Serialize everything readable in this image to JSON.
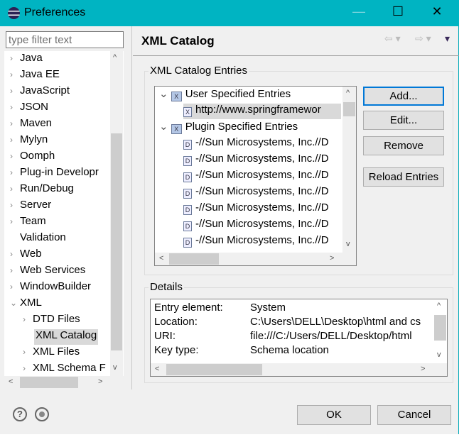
{
  "window": {
    "title": "Preferences",
    "minimize": "—",
    "maximize": "☐",
    "close": "✕"
  },
  "sidebar": {
    "filter_placeholder": "type filter text",
    "items": [
      {
        "label": "Java",
        "expanded": false,
        "level": 0
      },
      {
        "label": "Java EE",
        "expanded": false,
        "level": 0
      },
      {
        "label": "JavaScript",
        "expanded": false,
        "level": 0
      },
      {
        "label": "JSON",
        "expanded": false,
        "level": 0
      },
      {
        "label": "Maven",
        "expanded": false,
        "level": 0
      },
      {
        "label": "Mylyn",
        "expanded": false,
        "level": 0
      },
      {
        "label": "Oomph",
        "expanded": false,
        "level": 0
      },
      {
        "label": "Plug-in Developr",
        "expanded": false,
        "level": 0
      },
      {
        "label": "Run/Debug",
        "expanded": false,
        "level": 0
      },
      {
        "label": "Server",
        "expanded": false,
        "level": 0
      },
      {
        "label": "Team",
        "expanded": false,
        "level": 0
      },
      {
        "label": "Validation",
        "expanded": null,
        "level": 0
      },
      {
        "label": "Web",
        "expanded": false,
        "level": 0
      },
      {
        "label": "Web Services",
        "expanded": false,
        "level": 0
      },
      {
        "label": "WindowBuilder",
        "expanded": false,
        "level": 0
      },
      {
        "label": "XML",
        "expanded": true,
        "level": 0
      },
      {
        "label": "DTD Files",
        "expanded": false,
        "level": 1
      },
      {
        "label": "XML Catalog",
        "expanded": null,
        "level": 1,
        "selected": true
      },
      {
        "label": "XML Files",
        "expanded": false,
        "level": 1
      },
      {
        "label": "XML Schema F",
        "expanded": false,
        "level": 1
      }
    ]
  },
  "page": {
    "title": "XML Catalog",
    "entries_group": "XML Catalog Entries",
    "tree": [
      {
        "label": "User Specified Entries",
        "type": "category"
      },
      {
        "label": "http://www.springframewor",
        "type": "entry",
        "selected": true
      },
      {
        "label": "Plugin Specified Entries",
        "type": "category"
      },
      {
        "label": "-//Sun Microsystems, Inc.//D",
        "type": "dtd"
      },
      {
        "label": "-//Sun Microsystems, Inc.//D",
        "type": "dtd"
      },
      {
        "label": "-//Sun Microsystems, Inc.//D",
        "type": "dtd"
      },
      {
        "label": "-//Sun Microsystems, Inc.//D",
        "type": "dtd"
      },
      {
        "label": "-//Sun Microsystems, Inc.//D",
        "type": "dtd"
      },
      {
        "label": "-//Sun Microsystems, Inc.//D",
        "type": "dtd"
      },
      {
        "label": "-//Sun Microsystems, Inc.//D",
        "type": "dtd"
      }
    ],
    "buttons": {
      "add": "Add...",
      "edit": "Edit...",
      "remove": "Remove",
      "reload": "Reload Entries"
    },
    "details_group": "Details",
    "details": [
      {
        "label": "Entry element:",
        "value": "System"
      },
      {
        "label": "Location:",
        "value": "C:\\Users\\DELL\\Desktop\\html and cs"
      },
      {
        "label": "URI:",
        "value": "file:///C:/Users/DELL/Desktop/html"
      },
      {
        "label": "Key type:",
        "value": "Schema location"
      }
    ]
  },
  "footer": {
    "help": "?",
    "ok": "OK",
    "cancel": "Cancel"
  }
}
